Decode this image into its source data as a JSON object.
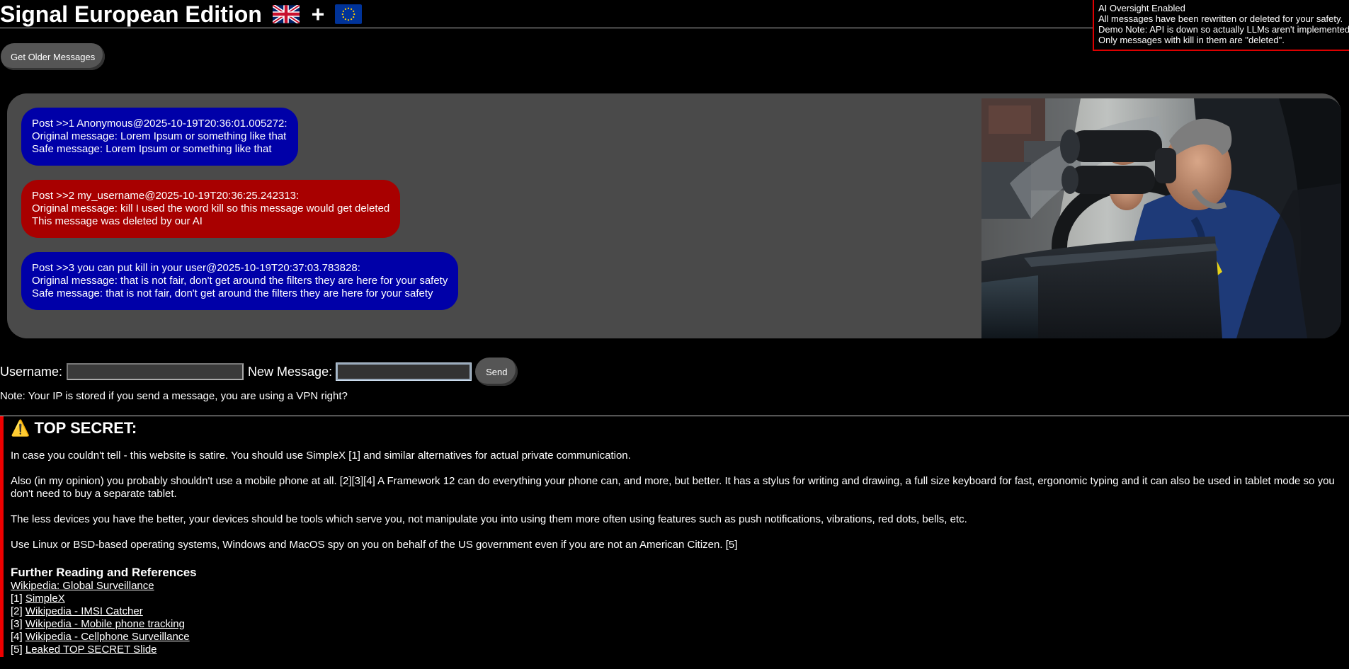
{
  "header": {
    "title": "Signal European Edition",
    "plus": "+"
  },
  "oversight": {
    "lines": [
      "AI Oversight Enabled",
      "All messages have been rewritten or deleted for your safety.",
      "Demo Note: API is down so actually LLMs aren't implemented",
      "Only messages with kill in them are \"deleted\"."
    ],
    "border_color": "#dd0000"
  },
  "older_button": {
    "label": "Get Older Messages"
  },
  "messages": [
    {
      "color": "blue",
      "header": "Post >>1 Anonymous@2025-10-19T20:36:01.005272:",
      "original": "Original message: Lorem Ipsum or something like that",
      "result": "Safe message: Lorem Ipsum or something like that"
    },
    {
      "color": "red",
      "header": "Post >>2 my_username@2025-10-19T20:36:25.242313:",
      "original": "Original message: kill I used the word kill so this message would get deleted",
      "result": "This message was deleted by our AI"
    },
    {
      "color": "blue",
      "header": "Post >>3 you can put kill in your user@2025-10-19T20:37:03.783828:",
      "original": "Original message: that is not fair, don't get around the filters they are here for your safety",
      "result": "Safe message: that is not fair, don't get around the filters they are here for your safety"
    }
  ],
  "compose": {
    "username_label": "Username:",
    "message_label": "New Message:",
    "username_value": "",
    "message_value": "",
    "send_label": "Send"
  },
  "ip_note": "Note: Your IP is stored if you send a message, you are using a VPN right?",
  "secret": {
    "icon": "⚠️",
    "title": "TOP SECRET:",
    "paragraphs": [
      "In case you couldn't tell - this website is satire. You should use SimpleX [1] and similar alternatives for actual private communication.",
      "Also (in my opinion) you probably shouldn't use a mobile phone at all. [2][3][4] A Framework 12 can do everything your phone can, and more, but better. It has a stylus for writing and drawing, a full size keyboard for fast, ergonomic typing and it can also be used in tablet mode so you don't need to buy a separate tablet.",
      "The less devices you have the better, your devices should be tools which serve you, not manipulate you into using them more often using features such as push notifications, vibrations, red dots, bells, etc.",
      "Use Linux or BSD-based operating systems, Windows and MacOS spy on you on behalf of the US government even if you are not an American Citizen. [5]"
    ],
    "refs_title": "Further Reading and References",
    "refs": [
      {
        "prefix": "",
        "label": "Wikipedia: Global Surveillance"
      },
      {
        "prefix": "[1] ",
        "label": "SimpleX"
      },
      {
        "prefix": "[2] ",
        "label": "Wikipedia - IMSI Catcher"
      },
      {
        "prefix": "[3] ",
        "label": "Wikipedia - Mobile phone tracking"
      },
      {
        "prefix": "[4] ",
        "label": "Wikipedia - Cellphone Surveillance"
      },
      {
        "prefix": "[5] ",
        "label": "Leaked TOP SECRET Slide"
      }
    ]
  },
  "image": {
    "subject": "man-with-binoculars-in-car"
  },
  "colors": {
    "background": "#000000",
    "panel": "#4a4a4a",
    "blue_bubble": "#0000a8",
    "red_bubble": "#a80000",
    "alert_red": "#ee0000"
  }
}
